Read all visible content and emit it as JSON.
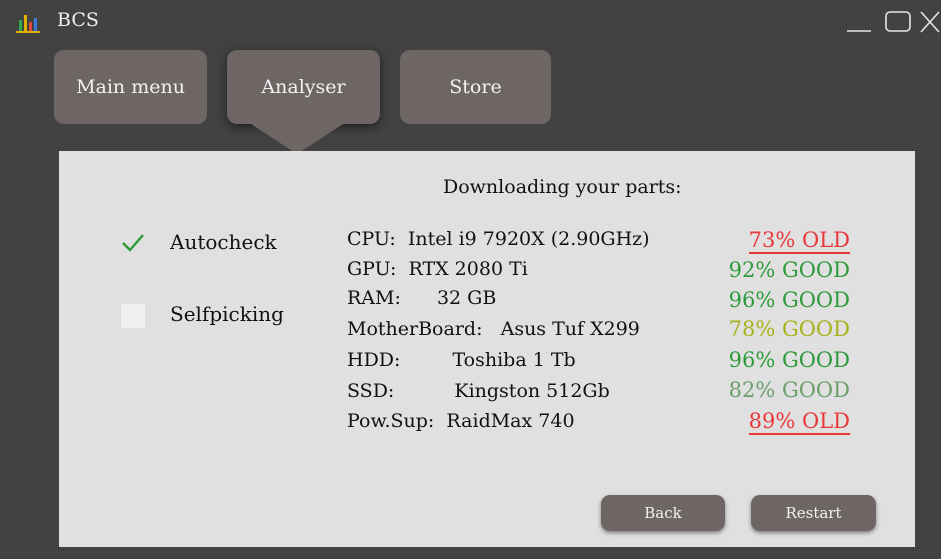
{
  "window": {
    "title": "BCS"
  },
  "nav": {
    "tabs": [
      {
        "label": "Main menu"
      },
      {
        "label": "Analyser"
      },
      {
        "label": "Store"
      }
    ],
    "active": "Analyser"
  },
  "panel": {
    "heading": "Downloading your parts:",
    "options": [
      {
        "label": "Autocheck",
        "checked": true
      },
      {
        "label": "Selfpicking",
        "checked": false
      }
    ],
    "parts": [
      {
        "label": "CPU:",
        "value": "Intel i9 7920X (2.90GHz)",
        "status": "73% OLD",
        "color": "#e8383a"
      },
      {
        "label": "GPU:",
        "value": "RTX 2080 Ti",
        "status": "92% GOOD",
        "color": "#2e9a3a"
      },
      {
        "label": "RAM:",
        "value": "32 GB",
        "status": "96% GOOD",
        "color": "#2e9a3a"
      },
      {
        "label": "MotherBoard:",
        "value": "Asus Tuf X299",
        "status": "78% GOOD",
        "color": "#a8b31a"
      },
      {
        "label": "HDD:",
        "value": "Toshiba 1 Tb",
        "status": "96% GOOD",
        "color": "#2e9a3a"
      },
      {
        "label": "SSD:",
        "value": "Kingston 512Gb",
        "status": "82% GOOD",
        "color": "#6c9e6c"
      },
      {
        "label": "Pow.Sup:",
        "value": "RaidMax 740",
        "status": "89% OLD",
        "color": "#e8383a"
      }
    ]
  },
  "buttons": {
    "back": "Back",
    "restart": "Restart"
  },
  "colors": {
    "check": "#2e9a3a",
    "logo_bars": [
      "#2ea84a",
      "#e0b000",
      "#d84a3a",
      "#3a7ad8"
    ]
  }
}
